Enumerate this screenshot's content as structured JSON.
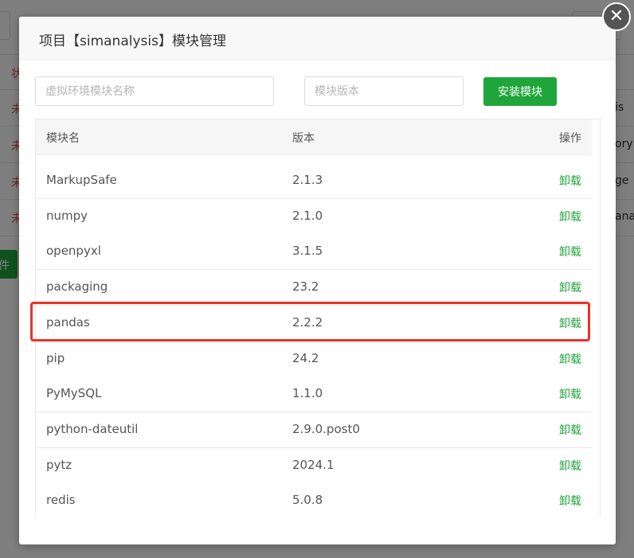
{
  "background": {
    "left_fragments": [
      "状",
      "未",
      "未",
      "未",
      "未"
    ],
    "right_fragments": [
      "is",
      "ory",
      "ge",
      "ana"
    ],
    "button_fragment": "件"
  },
  "dialog": {
    "title": "项目【simanalysis】模块管理",
    "close_icon": "close-icon",
    "module_name_placeholder": "虚拟环境模块名称",
    "module_version_placeholder": "模块版本",
    "install_label": "安装模块",
    "table": {
      "headers": {
        "name": "模块名",
        "version": "版本",
        "action": "操作"
      },
      "action_label": "卸载",
      "rows": [
        {
          "name": "MarkupSafe",
          "version": "2.1.3"
        },
        {
          "name": "numpy",
          "version": "2.1.0"
        },
        {
          "name": "openpyxl",
          "version": "3.1.5"
        },
        {
          "name": "packaging",
          "version": "23.2"
        },
        {
          "name": "pandas",
          "version": "2.2.2"
        },
        {
          "name": "pip",
          "version": "24.2"
        },
        {
          "name": "PyMySQL",
          "version": "1.1.0"
        },
        {
          "name": "python-dateutil",
          "version": "2.9.0.post0"
        },
        {
          "name": "pytz",
          "version": "2024.1"
        },
        {
          "name": "redis",
          "version": "5.0.8"
        }
      ]
    }
  },
  "colors": {
    "accent": "#20a53a",
    "highlight": "#e8332a",
    "background_status": "#d9534f"
  }
}
